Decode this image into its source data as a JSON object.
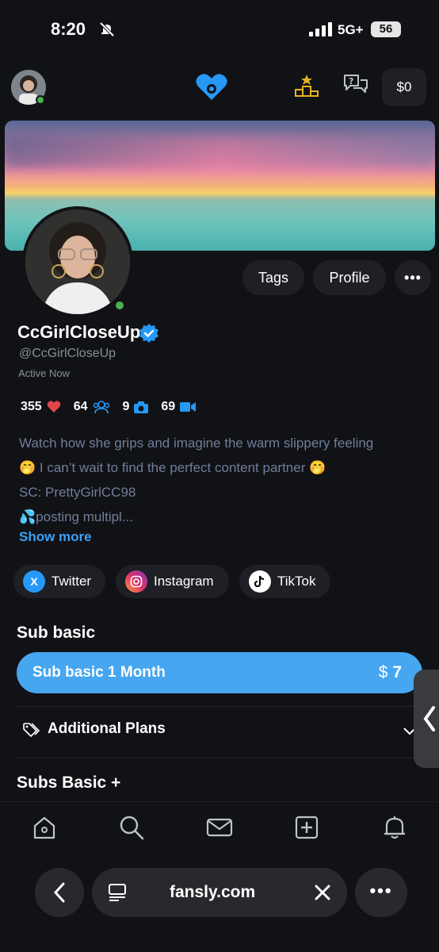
{
  "status_bar": {
    "time": "8:20",
    "network": "5G+",
    "battery": "56"
  },
  "top_nav": {
    "balance": "$0"
  },
  "profile": {
    "tags_label": "Tags",
    "profile_label": "Profile",
    "more_label": "•••",
    "display_name": "CcGirlCloseUp",
    "handle": "@CcGirlCloseUp",
    "status": "Active Now"
  },
  "stats": {
    "likes": "355",
    "subscribers": "64",
    "photos": "9",
    "videos": "69"
  },
  "bio": {
    "line1": "Watch how she grips and imagine the warm slippery feeling",
    "line2": "🤭 I can’t wait to find the perfect content partner 🤭",
    "line3": "SC: PrettyGirlCC98",
    "line4": "💦posting multipl...",
    "show_more": "Show more"
  },
  "socials": [
    {
      "label": "Twitter",
      "icon": "x-icon"
    },
    {
      "label": "Instagram",
      "icon": "instagram-icon"
    },
    {
      "label": "TikTok",
      "icon": "tiktok-icon"
    }
  ],
  "subscriptions": {
    "basic_title": "Sub basic",
    "plan_label": "Sub basic 1 Month",
    "plan_currency": "$",
    "plan_price": "7",
    "additional_label": "Additional Plans",
    "plus_title": "Subs Basic +"
  },
  "browser": {
    "url": "fansly.com",
    "more_label": "•••"
  },
  "colors": {
    "accent": "#46a6f0",
    "link": "#3aa0f5",
    "online": "#4caf50",
    "heart": "#e0474c",
    "brand": "#2699f6",
    "gold": "#e8b321"
  }
}
